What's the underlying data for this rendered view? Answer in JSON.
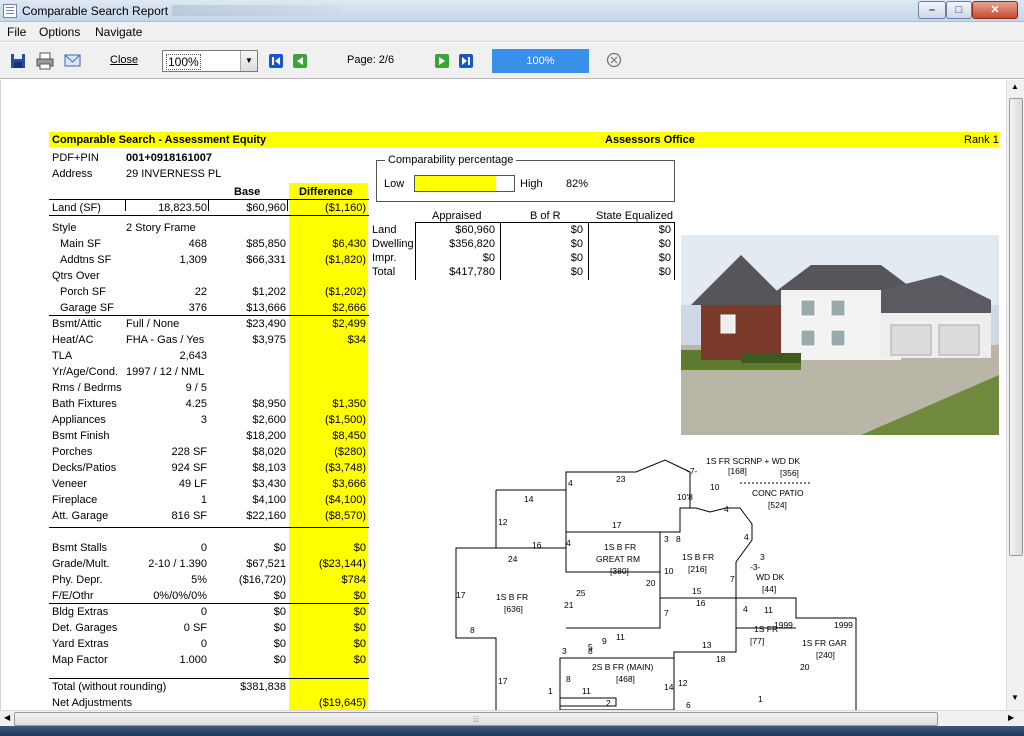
{
  "window": {
    "title": "Comparable Search Report",
    "min": "–",
    "max": "□",
    "close": "✕"
  },
  "menu": [
    "File",
    "Options",
    "Navigate"
  ],
  "toolbar": {
    "close_label": "Close",
    "zoom_value": "100%",
    "page_label": "Page: 2/6",
    "progress_label": "100%",
    "progress_fraction": 1.0,
    "icons": [
      "save-icon",
      "print-icon",
      "email-icon",
      "first-page-icon",
      "prev-page-icon",
      "next-page-icon",
      "last-page-icon",
      "help-icon"
    ]
  },
  "colors": {
    "highlight": "#ffff00",
    "progress": "#3a90e8",
    "nav_blue": "#1a56c8",
    "nav_green": "#3aa33a"
  },
  "report": {
    "title": "Comparable Search - Assessment Equity",
    "office": "Assessors Office",
    "rank": "Rank 1",
    "pin_label": "PDF+PIN",
    "pin_value": "001+0918161007",
    "address_label": "Address",
    "address_value": "29 INVERNESS PL",
    "col_base": "Base",
    "col_difference": "Difference",
    "rows": [
      {
        "label": "Land (SF)",
        "value": "18,823.50",
        "base": "$60,960",
        "diff": "($1,160)"
      },
      {
        "label": "Style",
        "value": "2 Story Frame",
        "base": "",
        "diff": ""
      },
      {
        "label": "Main SF",
        "value": "468",
        "base": "$85,850",
        "diff": "$6,430"
      },
      {
        "label": "Addtns SF",
        "value": "1,309",
        "base": "$66,331",
        "diff": "($1,820)"
      },
      {
        "label": "Qtrs Over",
        "value": "",
        "base": "",
        "diff": ""
      },
      {
        "label": "Porch SF",
        "value": "22",
        "base": "$1,202",
        "diff": "($1,202)"
      },
      {
        "label": "Garage SF",
        "value": "376",
        "base": "$13,666",
        "diff": "$2,666"
      },
      {
        "label": "Bsmt/Attic",
        "value": "Full / None",
        "base": "$23,490",
        "diff": "$2,499"
      },
      {
        "label": "Heat/AC",
        "value": "FHA - Gas / Yes",
        "base": "$3,975",
        "diff": "$34"
      },
      {
        "label": "TLA",
        "value": "2,643",
        "base": "",
        "diff": ""
      },
      {
        "label": "Yr/Age/Cond.",
        "value": "1997 / 12 / NML",
        "base": "",
        "diff": ""
      },
      {
        "label": "Rms / Bedrms",
        "value": "9 / 5",
        "base": "",
        "diff": ""
      },
      {
        "label": "Bath Fixtures",
        "value": "4.25",
        "base": "$8,950",
        "diff": "$1,350"
      },
      {
        "label": "Appliances",
        "value": "3",
        "base": "$2,600",
        "diff": "($1,500)"
      },
      {
        "label": "Bsmt Finish",
        "value": "",
        "base": "$18,200",
        "diff": "$8,450"
      },
      {
        "label": "Porches",
        "value": "228 SF",
        "base": "$8,020",
        "diff": "($280)"
      },
      {
        "label": "Decks/Patios",
        "value": "924 SF",
        "base": "$8,103",
        "diff": "($3,748)"
      },
      {
        "label": "Veneer",
        "value": "49 LF",
        "base": "$3,430",
        "diff": "$3,666"
      },
      {
        "label": "Fireplace",
        "value": "1",
        "base": "$4,100",
        "diff": "($4,100)"
      },
      {
        "label": "Att. Garage",
        "value": "816 SF",
        "base": "$22,160",
        "diff": "($8,570)"
      },
      {
        "label": "Bsmt Stalls",
        "value": "0",
        "base": "$0",
        "diff": "$0"
      },
      {
        "label": "Grade/Mult.",
        "value": "2-10 / 1.390",
        "base": "$67,521",
        "diff": "($23,144)"
      },
      {
        "label": "Phy. Depr.",
        "value": "5%",
        "base": "($16,720)",
        "diff": "$784"
      },
      {
        "label": "F/E/Othr",
        "value": "0%/0%/0%",
        "base": "$0",
        "diff": "$0"
      },
      {
        "label": "Bldg Extras",
        "value": "0",
        "base": "$0",
        "diff": "$0"
      },
      {
        "label": "Det. Garages",
        "value": "0 SF",
        "base": "$0",
        "diff": "$0"
      },
      {
        "label": "Yard Extras",
        "value": "0",
        "base": "$0",
        "diff": "$0"
      },
      {
        "label": "Map Factor",
        "value": "1.000",
        "base": "$0",
        "diff": "$0"
      }
    ],
    "total_label": "Total (without rounding)",
    "total_base": "$381,838",
    "net_label": "Net Adjustments",
    "net_diff": "($19,645)",
    "comparability": {
      "legend": "Comparability percentage",
      "low": "Low",
      "high": "High",
      "percent": "82%",
      "fraction": 0.82
    },
    "assessment": {
      "headers": [
        "Appraised",
        "B of R",
        "State Equalized"
      ],
      "rows": [
        {
          "label": "Land",
          "appraised": "$60,960",
          "bofr": "$0",
          "state": "$0"
        },
        {
          "label": "Dwelling",
          "appraised": "$356,820",
          "bofr": "$0",
          "state": "$0"
        },
        {
          "label": "Impr.",
          "appraised": "$0",
          "bofr": "$0",
          "state": "$0"
        },
        {
          "label": "Total",
          "appraised": "$417,780",
          "bofr": "$0",
          "state": "$0"
        }
      ]
    },
    "sketch_labels": [
      "1S FR SCRNP + WD DK",
      "[168]",
      "[356]",
      "-7-",
      "10",
      "CONC PATIO",
      "[524]",
      "23",
      "14",
      "4",
      "10'8",
      "12",
      "17",
      "4",
      "4",
      "16",
      "24",
      "4",
      "1S B FR",
      "GREAT RM",
      "[380]",
      "3",
      "8",
      "10",
      "20",
      "1S B FR",
      "[216]",
      "3",
      "-3-",
      "WD DK",
      "[44]",
      "7",
      "17",
      "1S B FR",
      "[636]",
      "25",
      "21",
      "15",
      "16",
      "7",
      "4",
      "11",
      "8",
      "5",
      "9",
      "11",
      "1S FR",
      "[77]",
      "13",
      "1999",
      "1999",
      "1S FR GAR",
      "[240]",
      "18",
      "20",
      "3",
      "8",
      "2S B FR (MAIN)",
      "[468]",
      "8",
      "17",
      "1",
      "11",
      "14",
      "12",
      "2",
      "6",
      "1"
    ]
  }
}
